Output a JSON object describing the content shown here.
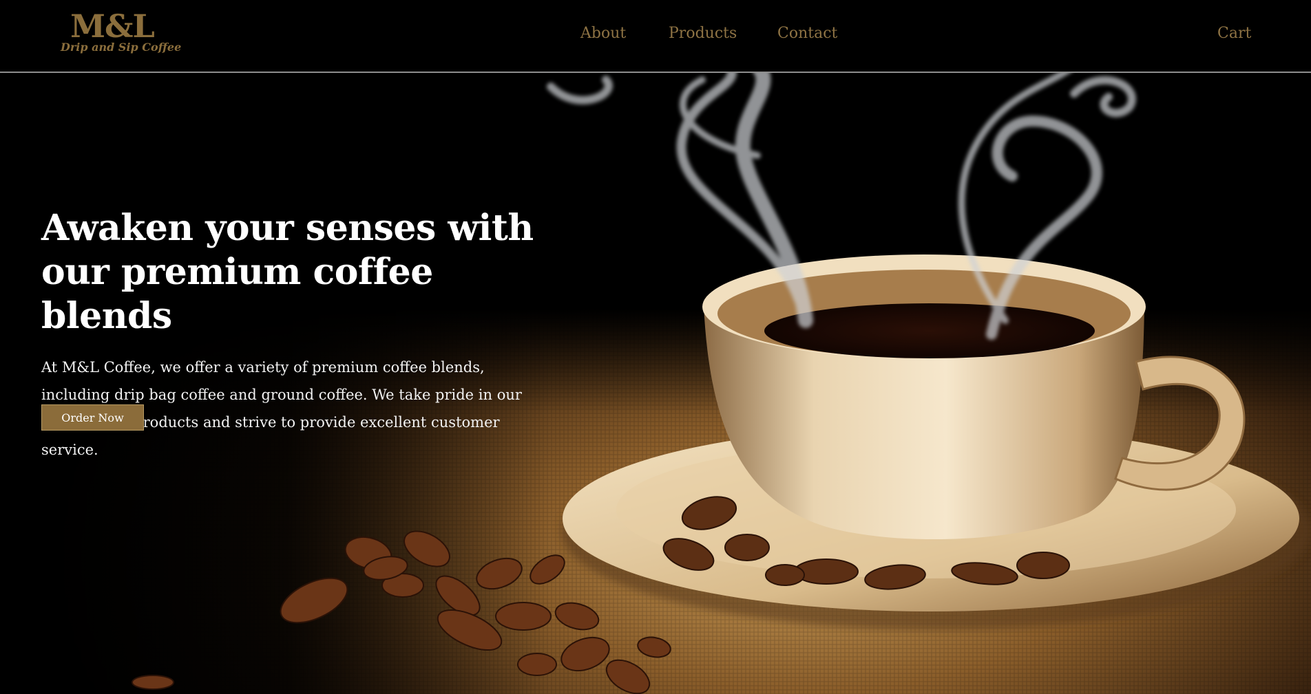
{
  "header": {
    "logo_mark": "M&L",
    "logo_tagline": "Drip and Sip Coffee",
    "nav": [
      {
        "label": "About"
      },
      {
        "label": "Products"
      },
      {
        "label": "Contact"
      }
    ],
    "cart_label": "Cart"
  },
  "hero": {
    "title_line1": "Awaken your senses with",
    "title_line2": "our premium coffee blends",
    "description": "At M&L Coffee, we offer a variety of premium coffee blends, including drip bag coffee and ground coffee. We take pride in our high-quality products and strive to provide excellent customer service.",
    "cta_label": "Order Now"
  },
  "colors": {
    "brand_gold": "#8b6e3c",
    "nav_text": "#8e7344",
    "button_bg": "#8b6c3a",
    "background": "#000000"
  }
}
